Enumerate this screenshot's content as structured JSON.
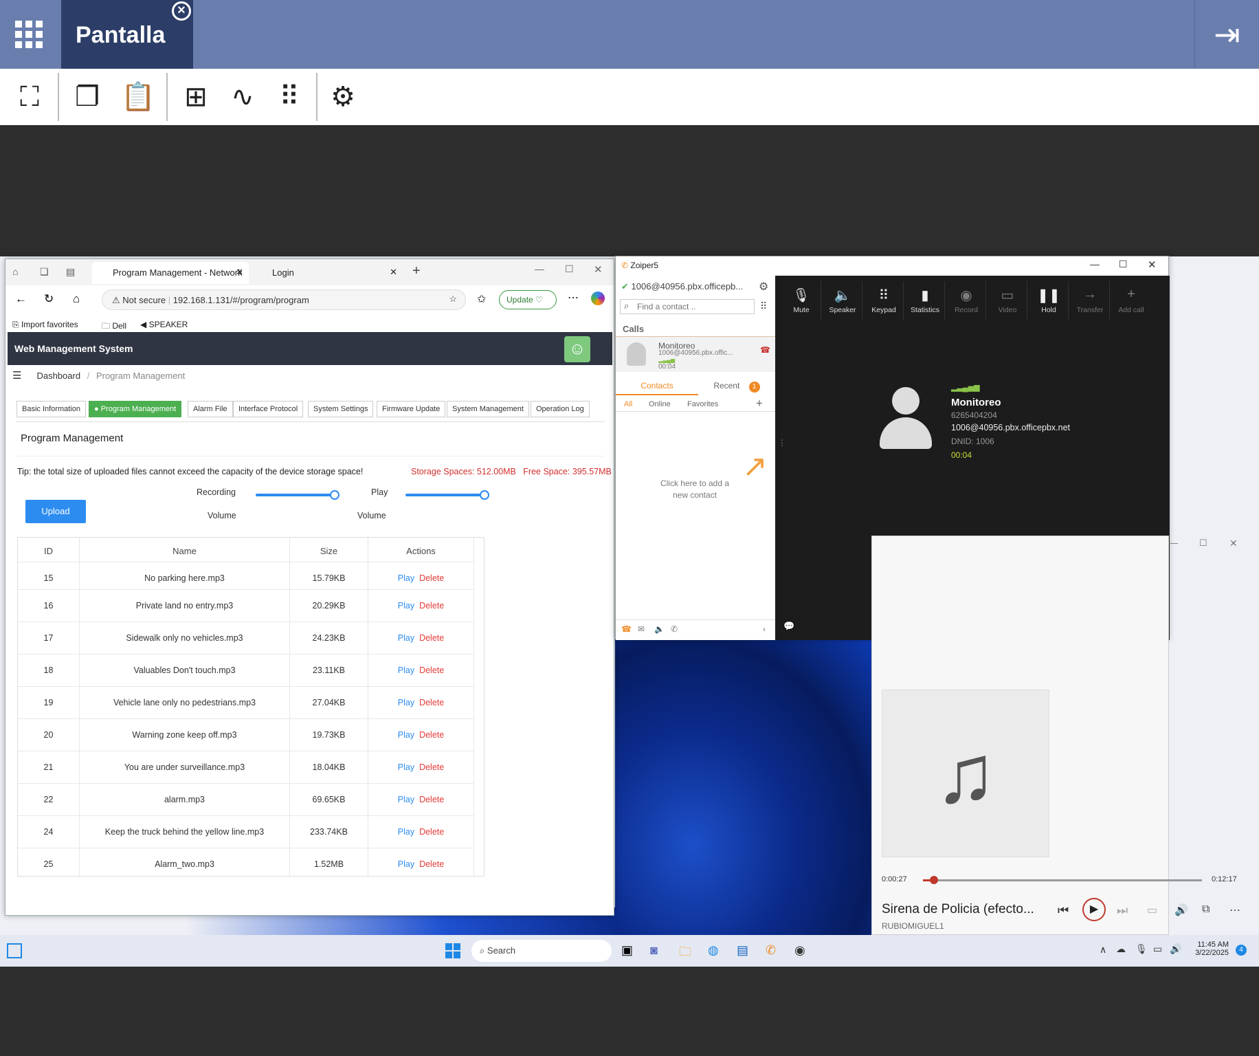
{
  "topbar": {
    "title": "Pantalla"
  },
  "browser": {
    "tabs": [
      {
        "label": "Program Management - Network"
      },
      {
        "label": "Login"
      }
    ],
    "security": "Not secure",
    "url": "192.168.1.131/#/program/program",
    "update": "Update",
    "favorites": [
      "Import favorites",
      "Dell",
      "SPEAKER"
    ],
    "app_title": "Web Management System",
    "breadcrumb": {
      "home": "Dashboard",
      "sep": "/",
      "current": "Program Management"
    },
    "page_tabs": [
      "Basic Information",
      "Program Management",
      "Alarm File",
      "Interface Protocol",
      "System Settings",
      "Firmware Update",
      "System Management",
      "Operation Log"
    ],
    "section_title": "Program Management",
    "tip": "Tip: the total size of uploaded files cannot exceed the capacity of the device storage space!",
    "storage": "Storage Spaces: 512.00MB",
    "free": "Free Space: 395.57MB",
    "upload": "Upload",
    "rec_label1": "Recording",
    "rec_label2": "Volume",
    "play_label1": "Play",
    "play_label2": "Volume",
    "recording_volume": 1.0,
    "play_volume": 1.0,
    "columns": {
      "id": "ID",
      "name": "Name",
      "size": "Size",
      "actions": "Actions"
    },
    "play": "Play",
    "delete": "Delete",
    "rows": [
      {
        "id": "15",
        "name": "No parking here.mp3",
        "size": "15.79KB"
      },
      {
        "id": "16",
        "name": "Private land no entry.mp3",
        "size": "20.29KB"
      },
      {
        "id": "17",
        "name": "Sidewalk only no vehicles.mp3",
        "size": "24.23KB"
      },
      {
        "id": "18",
        "name": "Valuables Don't touch.mp3",
        "size": "23.11KB"
      },
      {
        "id": "19",
        "name": "Vehicle lane only no pedestrians.mp3",
        "size": "27.04KB"
      },
      {
        "id": "20",
        "name": "Warning zone keep off.mp3",
        "size": "19.73KB"
      },
      {
        "id": "21",
        "name": "You are under surveillance.mp3",
        "size": "18.04KB"
      },
      {
        "id": "22",
        "name": "alarm.mp3",
        "size": "69.65KB"
      },
      {
        "id": "24",
        "name": "Keep the truck behind the yellow line.mp3",
        "size": "233.74KB"
      },
      {
        "id": "25",
        "name": "Alarm_two.mp3",
        "size": "1.52MB"
      }
    ]
  },
  "zoiper": {
    "title": "Zoiper5",
    "account": "1006@40956.pbx.officepb...",
    "search_placeholder": "Find a contact ..",
    "calls_label": "Calls",
    "call_item": {
      "name": "Monitoreo",
      "account": "1006@40956.pbx.offic...",
      "time": "00:04"
    },
    "tabs": {
      "contacts": "Contacts",
      "recent": "Recent",
      "recent_badge": "1"
    },
    "filters": [
      "All",
      "Online",
      "Favorites"
    ],
    "add_contact_hint1": "Click here to add a",
    "add_contact_hint2": "new contact",
    "controls": [
      "Mute",
      "Speaker",
      "Keypad",
      "Statistics",
      "Record",
      "Video",
      "Hold",
      "Transfer",
      "Add call"
    ],
    "caller": {
      "name": "Monitoreo",
      "number": "6265404204",
      "uri": "1006@40956.pbx.officepbx.net",
      "dnid": "DNID: 1006",
      "time": "00:04"
    }
  },
  "media": {
    "elapsed": "0:00:27",
    "total": "0:12:17",
    "progress": 0.04,
    "title": "Sirena de Policia (efecto...",
    "artist": "RUBIOMIGUEL1"
  },
  "taskbar": {
    "search": "Search",
    "time": "11:45 AM",
    "date": "3/22/2025",
    "badge": "4"
  },
  "colors": {
    "topbar": "#6a7eae",
    "tab_active": "#2c3e67",
    "accent_green": "#4caf50",
    "zoiper_orange": "#f08a24",
    "hangup": "#c62828"
  }
}
